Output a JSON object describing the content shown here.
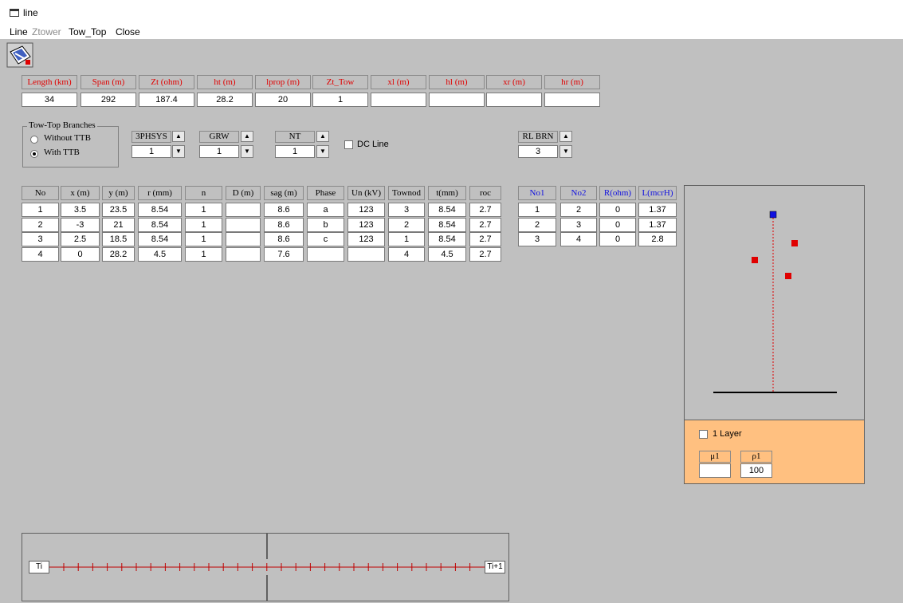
{
  "window": {
    "title": "line"
  },
  "menu": {
    "items": [
      "Line",
      "Ztower",
      "Tow_Top",
      "Close"
    ]
  },
  "params": {
    "headers": [
      "Length (km)",
      "Span (m)",
      "Zt (ohm)",
      "ht (m)",
      "lprop (m)",
      "Zt_Tow",
      "xl (m)",
      "hl (m)",
      "xr (m)",
      "hr (m)"
    ],
    "values": [
      "34",
      "292",
      "187.4",
      "28.2",
      "20",
      "1",
      "",
      "",
      "",
      ""
    ]
  },
  "branches": {
    "title": "Tow-Top Branches",
    "options": [
      "Without TTB",
      "With TTB"
    ],
    "selected": 1
  },
  "spinners": {
    "phsys": {
      "label": "3PHSYS",
      "value": "1"
    },
    "grw": {
      "label": "GRW",
      "value": "1"
    },
    "nt": {
      "label": "NT",
      "value": "1"
    },
    "rlbrn": {
      "label": "RL BRN",
      "value": "3"
    }
  },
  "dc_line": {
    "label": "DC Line",
    "checked": false
  },
  "conductors": {
    "headers": [
      "No",
      "x (m)",
      "y (m)",
      "r (mm)",
      "n",
      "D (m)",
      "sag (m)",
      "Phase",
      "Un (kV)",
      "Townod",
      "t(mm)",
      "roc"
    ],
    "rows": [
      [
        "1",
        "3.5",
        "23.5",
        "8.54",
        "1",
        "",
        "8.6",
        "a",
        "123",
        "3",
        "8.54",
        "2.7"
      ],
      [
        "2",
        "-3",
        "21",
        "8.54",
        "1",
        "",
        "8.6",
        "b",
        "123",
        "2",
        "8.54",
        "2.7"
      ],
      [
        "3",
        "2.5",
        "18.5",
        "8.54",
        "1",
        "",
        "8.6",
        "c",
        "123",
        "1",
        "8.54",
        "2.7"
      ],
      [
        "4",
        "0",
        "28.2",
        "4.5",
        "1",
        "",
        "7.6",
        "",
        "",
        "4",
        "4.5",
        "2.7"
      ]
    ]
  },
  "rl_branches": {
    "headers": [
      "No1",
      "No2",
      "R(ohm)",
      "L(mcrH)"
    ],
    "rows": [
      [
        "1",
        "2",
        "0",
        "1.37"
      ],
      [
        "2",
        "3",
        "0",
        "1.37"
      ],
      [
        "3",
        "4",
        "0",
        "2.8"
      ]
    ]
  },
  "soil": {
    "layer_label": "1 Layer",
    "layer_checked": false,
    "headers": [
      "μ1",
      "ρ1"
    ],
    "values": [
      "",
      "100"
    ]
  },
  "line_view": {
    "left_label": "Ti",
    "right_label": "Ti+1"
  },
  "colors": {
    "accent_red": "#e00000",
    "accent_blue": "#1010e0",
    "soil_bg": "#ffc080"
  }
}
